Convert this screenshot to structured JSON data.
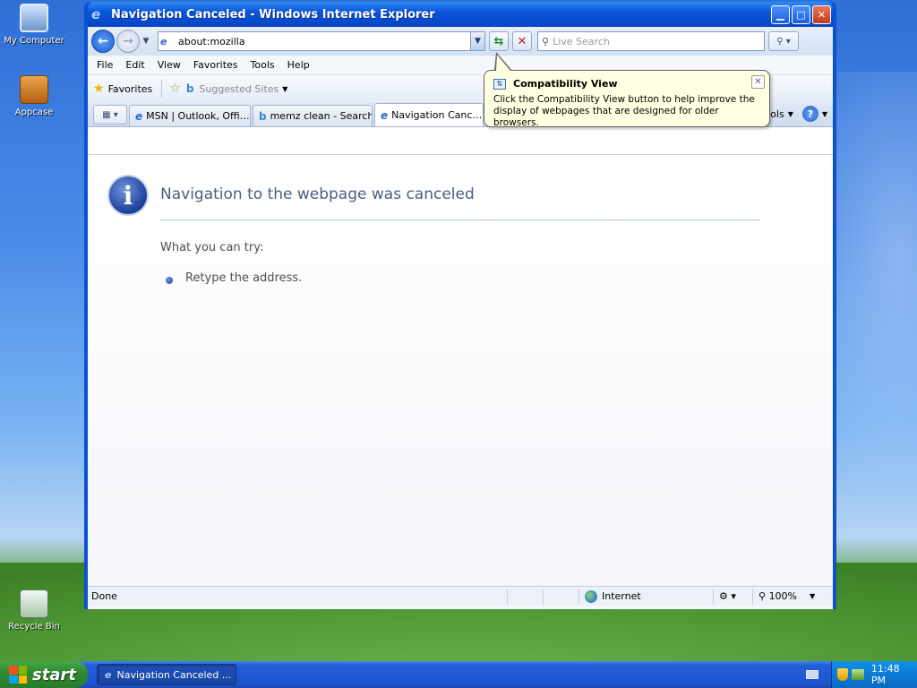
{
  "desktop": {
    "icons": [
      {
        "label": "My Computer"
      },
      {
        "label": "Appcase"
      },
      {
        "label": "Recycle Bin"
      }
    ]
  },
  "window": {
    "title": "Navigation Canceled - Windows Internet Explorer"
  },
  "address_bar": {
    "url": "about:mozilla",
    "search_placeholder": "Live Search"
  },
  "menu": {
    "items": [
      "File",
      "Edit",
      "View",
      "Favorites",
      "Tools",
      "Help"
    ]
  },
  "favorites_bar": {
    "favorites_label": "Favorites",
    "suggested_label": "Suggested Sites"
  },
  "tabs": {
    "items": [
      {
        "label": "MSN | Outlook, Offi…",
        "icon": "ie"
      },
      {
        "label": "memz clean - Search",
        "icon": "bing"
      },
      {
        "label": "Navigation Canc…",
        "icon": "ie",
        "active": true
      }
    ],
    "tools_label": "ols",
    "help_symbol": "?"
  },
  "tooltip": {
    "title": "Compatibility View",
    "body": "Click the Compatibility View button to help improve the display of webpages that are designed for older browsers."
  },
  "page": {
    "heading": "Navigation to the webpage was canceled",
    "what_you_can_try": "What you can try:",
    "suggestion": "Retype the address."
  },
  "status_bar": {
    "status": "Done",
    "zone": "Internet",
    "zoom": "100%"
  },
  "taskbar": {
    "start_label": "start",
    "task_button": "Navigation Canceled ...",
    "clock": "11:48 PM"
  }
}
